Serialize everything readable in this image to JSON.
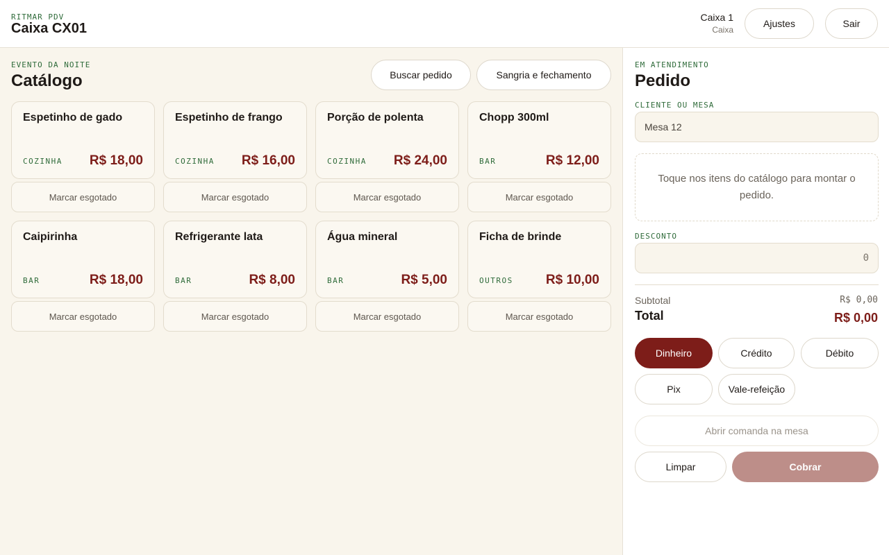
{
  "header": {
    "kicker": "RITMAR PDV",
    "title": "Caixa CX01",
    "user_name": "Caixa 1",
    "user_role": "Caixa",
    "settings_label": "Ajustes",
    "logout_label": "Sair"
  },
  "catalog": {
    "kicker": "EVENTO DA NOITE",
    "title": "Catálogo",
    "search_order_label": "Buscar pedido",
    "cash_close_label": "Sangria e fechamento",
    "sold_out_label": "Marcar esgotado",
    "items": [
      {
        "name": "Espetinho de gado",
        "category": "COZINHA",
        "price": "R$ 18,00"
      },
      {
        "name": "Espetinho de frango",
        "category": "COZINHA",
        "price": "R$ 16,00"
      },
      {
        "name": "Porção de polenta",
        "category": "COZINHA",
        "price": "R$ 24,00"
      },
      {
        "name": "Chopp 300ml",
        "category": "BAR",
        "price": "R$ 12,00"
      },
      {
        "name": "Caipirinha",
        "category": "BAR",
        "price": "R$ 18,00"
      },
      {
        "name": "Refrigerante lata",
        "category": "BAR",
        "price": "R$ 8,00"
      },
      {
        "name": "Água mineral",
        "category": "BAR",
        "price": "R$ 5,00"
      },
      {
        "name": "Ficha de brinde",
        "category": "OUTROS",
        "price": "R$ 10,00"
      }
    ]
  },
  "order": {
    "kicker": "EM ATENDIMENTO",
    "title": "Pedido",
    "customer_label": "CLIENTE OU MESA",
    "customer_value": "Mesa 12",
    "empty_hint": "Toque nos itens do catálogo para montar o pedido.",
    "discount_label": "DESCONTO",
    "discount_value": "0",
    "subtotal_label": "Subtotal",
    "subtotal_value": "R$ 0,00",
    "total_label": "Total",
    "total_value": "R$ 0,00",
    "payment_methods": [
      "Dinheiro",
      "Crédito",
      "Débito",
      "Pix",
      "Vale-refeição"
    ],
    "selected_payment": "Dinheiro",
    "open_tab_label": "Abrir comanda na mesa",
    "clear_label": "Limpar",
    "charge_label": "Cobrar"
  },
  "colors": {
    "accent": "#7d1d19",
    "accent_disabled": "#bd8e89",
    "category_green": "#2f6b3a",
    "background": "#f9f5ec"
  }
}
